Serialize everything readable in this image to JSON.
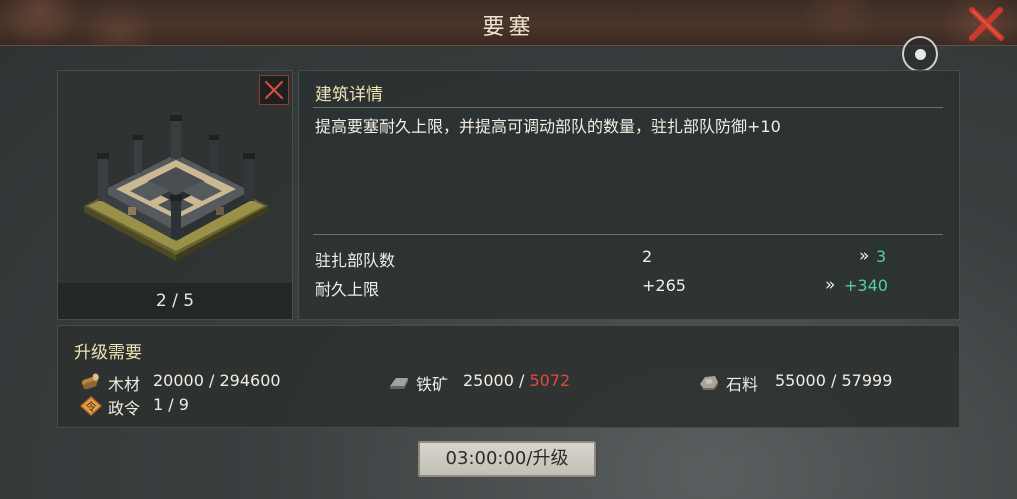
{
  "header": {
    "title": "要塞"
  },
  "building": {
    "level_text": "2 / 5",
    "level_current": 2,
    "level_max": 5
  },
  "details": {
    "section_title": "建筑详情",
    "description": "提高要塞耐久上限，并提高可调动部队的数量，驻扎部队防御+10",
    "stats": [
      {
        "name": "驻扎部队数",
        "current": "2",
        "arrow": "»",
        "next": "3"
      },
      {
        "name": "耐久上限",
        "current": "+265",
        "arrow": "»",
        "next": "+340"
      }
    ]
  },
  "requirements": {
    "section_title": "升级需要",
    "items": [
      {
        "icon": "wood-icon",
        "label": "木材",
        "required": "20000",
        "sep": " / ",
        "owned": "294600",
        "insufficient": false
      },
      {
        "icon": "iron-ore-icon",
        "label": "铁矿",
        "required": "25000",
        "sep": " / ",
        "owned": "5072",
        "insufficient": true
      },
      {
        "icon": "stone-icon",
        "label": "石料",
        "required": "55000",
        "sep": " / ",
        "owned": "57999",
        "insufficient": false
      },
      {
        "icon": "decree-icon",
        "label": "政令",
        "required": "1",
        "sep": " / ",
        "owned": "9",
        "insufficient": false
      }
    ]
  },
  "action": {
    "upgrade_label": "03:00:00/升级"
  },
  "colors": {
    "accent_green": "#4fd1a0",
    "insufficient_red": "#e0493c",
    "title_gold": "#efe2b4",
    "close_red": "#c0392b"
  }
}
